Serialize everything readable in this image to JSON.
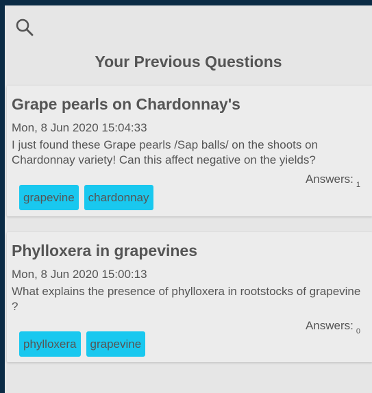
{
  "header": {
    "search_icon": "search-icon",
    "title": "Your Previous Questions"
  },
  "questions": [
    {
      "title": "Grape pearls on Chardonnay's",
      "date": "Mon, 8 Jun 2020 15:04:33",
      "body": "I just found these Grape pearls /Sap balls/ on the shoots on Chardonnay variety! Can this affect negative on the yields?",
      "answers_label": "Answers:",
      "answers_count": "1",
      "tags": [
        "grapevine",
        "chardonnay"
      ]
    },
    {
      "title": "Phylloxera in grapevines",
      "date": "Mon, 8 Jun 2020 15:00:13",
      "body": "What explains the presence of phylloxera in rootstocks of grapevine ?",
      "answers_label": "Answers:",
      "answers_count": "0",
      "tags": [
        "phylloxera",
        "grapevine"
      ]
    }
  ],
  "colors": {
    "tag_background": "#19c8ef",
    "page_background": "#e6e6e6",
    "text": "#555555"
  }
}
